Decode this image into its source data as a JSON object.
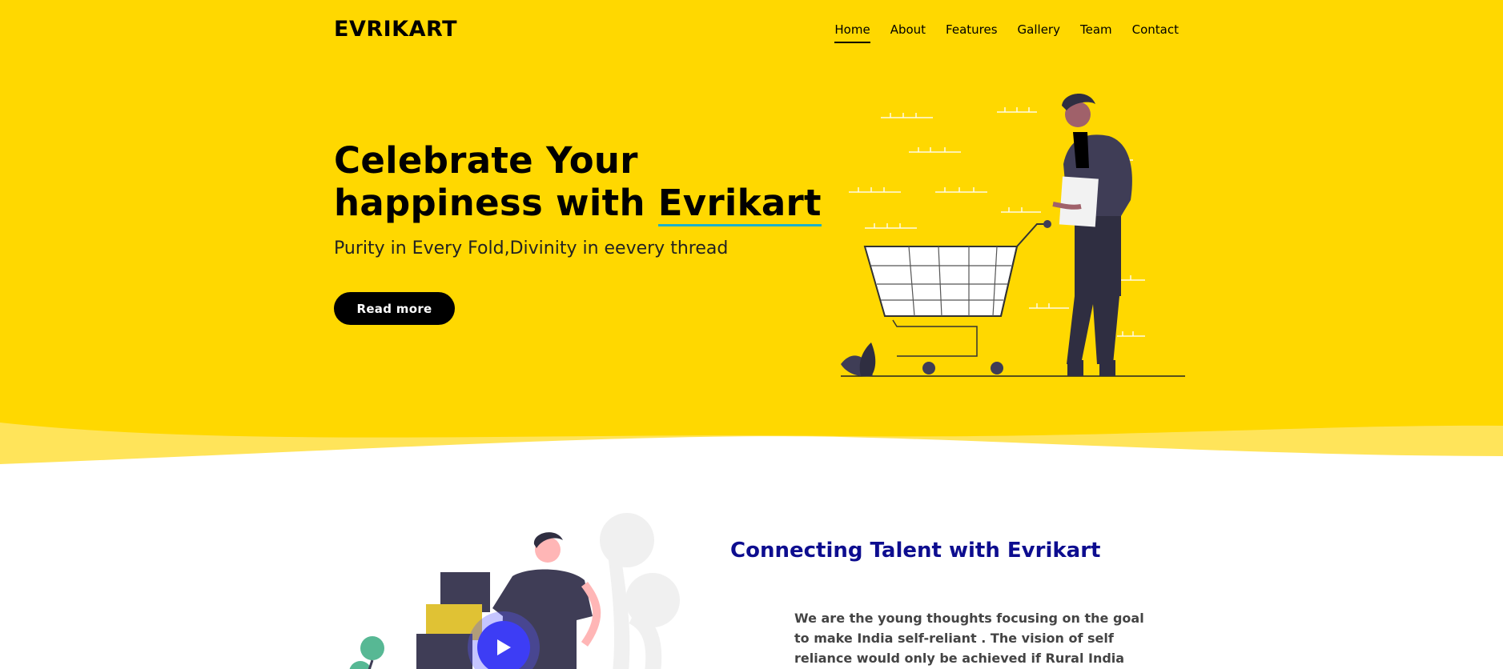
{
  "brand": {
    "logo": "EVRIKART"
  },
  "nav": {
    "items": [
      {
        "label": "Home",
        "active": true
      },
      {
        "label": "About"
      },
      {
        "label": "Features"
      },
      {
        "label": "Gallery"
      },
      {
        "label": "Team"
      },
      {
        "label": "Contact"
      }
    ]
  },
  "hero": {
    "title_line1": "Celebrate Your",
    "title_line2_prefix": "happiness with ",
    "title_line2_highlight": "Evrikart",
    "subtitle": "Purity in Every Fold,Divinity in eevery thread",
    "cta_label": "Read more"
  },
  "about": {
    "title": "Connecting Talent with Evrikart",
    "body": "We are the young thoughts focusing on the goal to make India self-reliant . The vision of self reliance would only be achieved if Rural India becomes self-"
  },
  "colors": {
    "hero_bg": "#ffd800",
    "accent_underline": "#1cb1c8",
    "section_title": "#0d0d8f",
    "play_button": "#3d3df5"
  }
}
